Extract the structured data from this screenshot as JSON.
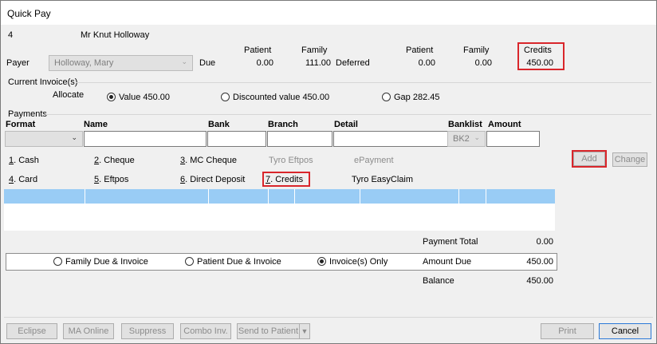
{
  "window": {
    "title": "Quick Pay"
  },
  "patient": {
    "number": "4",
    "name": "Mr Knut Holloway"
  },
  "summary": {
    "payer_label": "Payer",
    "payer_value": "Holloway, Mary",
    "due_label": "Due",
    "deferred_label": "Deferred",
    "headers": {
      "patient1": "Patient",
      "family1": "Family",
      "patient2": "Patient",
      "family2": "Family",
      "credits": "Credits"
    },
    "due_patient": "0.00",
    "due_family": "111.00",
    "deferred_patient": "0.00",
    "deferred_family": "0.00",
    "credits": "450.00"
  },
  "invoices": {
    "group_label": "Current Invoice(s)",
    "allocate_label": "Allocate",
    "options": [
      {
        "label": "Value 450.00",
        "selected": true
      },
      {
        "label": "Discounted value 450.00",
        "selected": false
      },
      {
        "label": "Gap 282.45",
        "selected": false
      }
    ]
  },
  "payments": {
    "group_label": "Payments",
    "columns": {
      "format": "Format",
      "name": "Name",
      "bank": "Bank",
      "branch": "Branch",
      "detail": "Detail",
      "banklist": "Banklist",
      "amount": "Amount"
    },
    "banklist_value": "BK2",
    "methods_row1": [
      {
        "key": "1",
        "rest": ". Cash",
        "enabled": true
      },
      {
        "key": "2",
        "rest": ". Cheque",
        "enabled": true
      },
      {
        "key": "3",
        "rest": ". MC Cheque",
        "enabled": true
      },
      {
        "key": "",
        "rest": "Tyro Eftpos",
        "enabled": false
      },
      {
        "key": "",
        "rest": "ePayment",
        "enabled": false
      }
    ],
    "methods_row2": [
      {
        "key": "4",
        "rest": ". Card",
        "enabled": true
      },
      {
        "key": "5",
        "rest": ". Eftpos",
        "enabled": true
      },
      {
        "key": "6",
        "rest": ". Direct Deposit",
        "enabled": true
      },
      {
        "key": "7",
        "rest": ". Credits",
        "enabled": true
      },
      {
        "key": "",
        "rest": "Tyro EasyClaim",
        "enabled": true
      }
    ],
    "add_label": "Add",
    "change_label": "Change"
  },
  "totals": {
    "payment_total_label": "Payment Total",
    "payment_total": "0.00",
    "amount_due_label": "Amount Due",
    "amount_due": "450.00",
    "balance_label": "Balance",
    "balance": "450.00"
  },
  "due_options": [
    {
      "label": "Family Due & Invoice",
      "selected": false
    },
    {
      "label": "Patient Due & Invoice",
      "selected": false
    },
    {
      "label": "Invoice(s) Only",
      "selected": true
    }
  ],
  "footer": {
    "eclipse": "Eclipse",
    "ma_online": "MA Online",
    "suppress": "Suppress",
    "combo_inv": "Combo Inv.",
    "send_to_patient": "Send to Patient",
    "print": "Print",
    "cancel": "Cancel"
  },
  "colors": {
    "highlight_red": "#d9262b",
    "grid_selection": "#99ccf5"
  }
}
